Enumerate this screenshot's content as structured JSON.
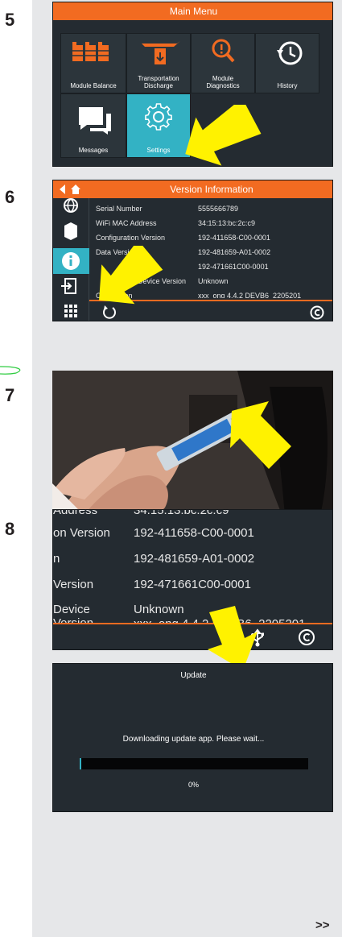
{
  "steps": [
    "5",
    "6",
    "7",
    "8"
  ],
  "main_menu": {
    "title": "Main Menu",
    "tiles": [
      {
        "label": "Module Balance",
        "icon": "battery-modules-icon"
      },
      {
        "label": "Transportation Discharge",
        "icon": "airplane-discharge-icon"
      },
      {
        "label": "Module Diagnostics",
        "icon": "module-diagnostics-icon"
      },
      {
        "label": "History",
        "icon": "history-icon"
      },
      {
        "label": "Messages",
        "icon": "messages-icon"
      },
      {
        "label": "Settings",
        "icon": "gear-icon"
      }
    ]
  },
  "version_info": {
    "title": "Version Information",
    "rows": [
      {
        "key": "Serial Number",
        "value": "5555666789"
      },
      {
        "key": "WiFi MAC Address",
        "value": "34:15:13:bc:2c:c9"
      },
      {
        "key": "Configuration Version",
        "value": "192-411658-C00-0001"
      },
      {
        "key": "Data Version",
        "value": "192-481659-A01-0002"
      },
      {
        "key": "Version",
        "value": "192-471661C00-0001"
      },
      {
        "key": "Device Version",
        "value": "Unknown"
      },
      {
        "key": "OS Version",
        "value": "xxx_ong 4.4.2 DEVB6_2205201"
      }
    ]
  },
  "zoomed_versions": {
    "rows": [
      {
        "key": "Address",
        "value": "34:15:13:bc:2c:c9"
      },
      {
        "key": "on Version",
        "value": "192-411658-C00-0001"
      },
      {
        "key": "n",
        "value": "192-481659-A01-0002"
      },
      {
        "key": "Version",
        "value": "192-471661C00-0001"
      },
      {
        "key": "Device Version",
        "value": "Unknown"
      },
      {
        "key": "",
        "value": "xxx_ong 4.4.2 DEVB6_2205201"
      }
    ]
  },
  "update": {
    "title": "Update",
    "message": "Downloading update app. Please wait...",
    "progress_text": "0%",
    "progress": 0
  },
  "next_label": ">>",
  "colors": {
    "accent": "#f26b21",
    "teal": "#33b2c4",
    "arrow": "#fff200",
    "screen": "#242b31"
  }
}
